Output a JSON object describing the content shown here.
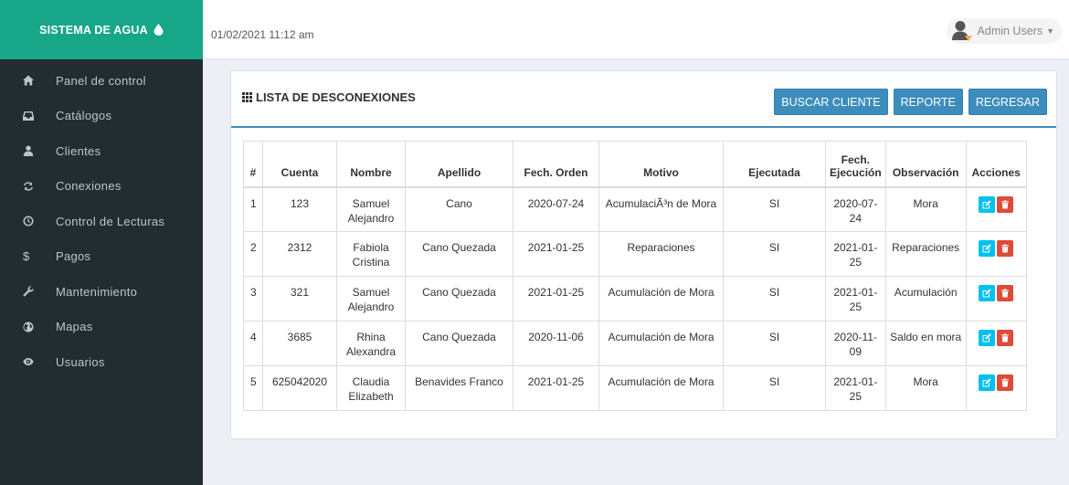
{
  "brand": {
    "title": "SISTEMA DE AGUA",
    "icon": "water-drop-icon"
  },
  "sidebar": {
    "items": [
      {
        "label": "Panel de control",
        "icon": "home-icon"
      },
      {
        "label": "Catálogos",
        "icon": "inbox-icon"
      },
      {
        "label": "Clientes",
        "icon": "user-icon"
      },
      {
        "label": "Conexiones",
        "icon": "refresh-icon"
      },
      {
        "label": "Control de Lecturas",
        "icon": "clock-icon"
      },
      {
        "label": "Pagos",
        "icon": "dollar-icon"
      },
      {
        "label": "Mantenimiento",
        "icon": "wrench-icon"
      },
      {
        "label": "Mapas",
        "icon": "globe-icon"
      },
      {
        "label": "Usuarios",
        "icon": "eye-icon"
      }
    ]
  },
  "header": {
    "datetime": "01/02/2021 11:12 am",
    "user": "Admin Users"
  },
  "panel": {
    "title": "LISTA DE DESCONEXIONES",
    "buttons": {
      "search": "BUSCAR CLIENTE",
      "report": "REPORTE",
      "back": "REGRESAR"
    }
  },
  "table": {
    "headers": [
      "#",
      "Cuenta",
      "Nombre",
      "Apellido",
      "Fech. Orden",
      "Motivo",
      "Ejecutada",
      "Fech. Ejecución",
      "Observación",
      "Acciones"
    ],
    "rows": [
      {
        "num": "1",
        "cuenta": "123",
        "nombre": "Samuel Alejandro",
        "apellido": "Cano",
        "orden": "2020-07-24",
        "motivo": "AcumulaciÃ³n de Mora",
        "ejecutada": "SI",
        "ejecucion": "2020-07-24",
        "observacion": "Mora"
      },
      {
        "num": "2",
        "cuenta": "2312",
        "nombre": "Fabiola Cristina",
        "apellido": "Cano Quezada",
        "orden": "2021-01-25",
        "motivo": "Reparaciones",
        "ejecutada": "SI",
        "ejecucion": "2021-01-25",
        "observacion": "Reparaciones"
      },
      {
        "num": "3",
        "cuenta": "321",
        "nombre": "Samuel Alejandro",
        "apellido": "Cano Quezada",
        "orden": "2021-01-25",
        "motivo": "Acumulación de Mora",
        "ejecutada": "SI",
        "ejecucion": "2021-01-25",
        "observacion": "Acumulación"
      },
      {
        "num": "4",
        "cuenta": "3685",
        "nombre": "Rhina Alexandra",
        "apellido": "Cano Quezada",
        "orden": "2020-11-06",
        "motivo": "Acumulación de Mora",
        "ejecutada": "SI",
        "ejecucion": "2020-11-09",
        "observacion": "Saldo en mora"
      },
      {
        "num": "5",
        "cuenta": "625042020",
        "nombre": "Claudia Elizabeth",
        "apellido": "Benavides Franco",
        "orden": "2021-01-25",
        "motivo": "Acumulación de Mora",
        "ejecutada": "SI",
        "ejecucion": "2021-01-25",
        "observacion": "Mora"
      }
    ],
    "action_icons": {
      "edit": "edit-icon",
      "delete": "trash-icon"
    }
  },
  "colors": {
    "brand": "#18a689",
    "sidebar": "#222d32",
    "primary": "#3c8dbc",
    "edit": "#00c0ef",
    "delete": "#dd4b39"
  }
}
